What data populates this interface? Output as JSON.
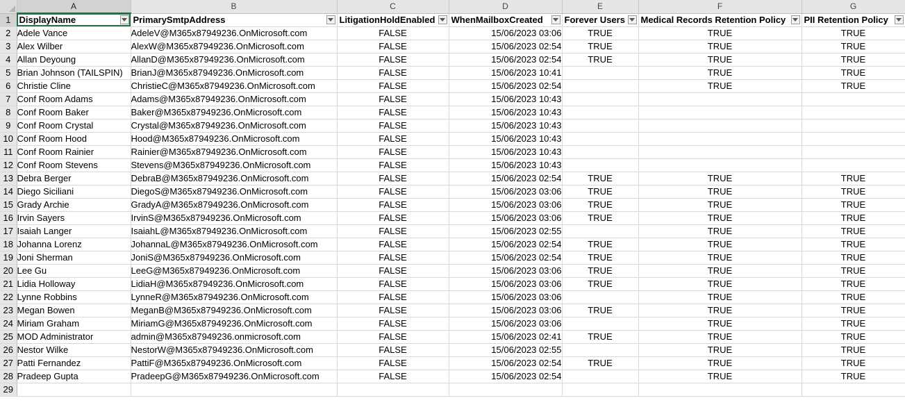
{
  "column_letters": [
    "A",
    "B",
    "C",
    "D",
    "E",
    "F",
    "G"
  ],
  "selected_column": "A",
  "headers": [
    "DisplayName",
    "PrimarySmtpAddress",
    "LitigationHoldEnabled",
    "WhenMailboxCreated",
    "Forever Users",
    "Medical Records Retention Policy",
    "PII Retention Policy"
  ],
  "header_row_number": "1",
  "rows": [
    {
      "num": "2",
      "cells": [
        "Adele Vance",
        "AdeleV@M365x87949236.OnMicrosoft.com",
        "FALSE",
        "15/06/2023 03:06",
        "TRUE",
        "TRUE",
        "TRUE"
      ]
    },
    {
      "num": "3",
      "cells": [
        "Alex Wilber",
        "AlexW@M365x87949236.OnMicrosoft.com",
        "FALSE",
        "15/06/2023 02:54",
        "TRUE",
        "TRUE",
        "TRUE"
      ]
    },
    {
      "num": "4",
      "cells": [
        "Allan Deyoung",
        "AllanD@M365x87949236.OnMicrosoft.com",
        "FALSE",
        "15/06/2023 02:54",
        "TRUE",
        "TRUE",
        "TRUE"
      ]
    },
    {
      "num": "5",
      "cells": [
        "Brian Johnson (TAILSPIN)",
        "BrianJ@M365x87949236.OnMicrosoft.com",
        "FALSE",
        "15/06/2023 10:41",
        "",
        "TRUE",
        "TRUE"
      ]
    },
    {
      "num": "6",
      "cells": [
        "Christie Cline",
        "ChristieC@M365x87949236.OnMicrosoft.com",
        "FALSE",
        "15/06/2023 02:54",
        "",
        "TRUE",
        "TRUE"
      ]
    },
    {
      "num": "7",
      "cells": [
        "Conf Room Adams",
        "Adams@M365x87949236.OnMicrosoft.com",
        "FALSE",
        "15/06/2023 10:43",
        "",
        "",
        ""
      ]
    },
    {
      "num": "8",
      "cells": [
        "Conf Room Baker",
        "Baker@M365x87949236.OnMicrosoft.com",
        "FALSE",
        "15/06/2023 10:43",
        "",
        "",
        ""
      ]
    },
    {
      "num": "9",
      "cells": [
        "Conf Room Crystal",
        "Crystal@M365x87949236.OnMicrosoft.com",
        "FALSE",
        "15/06/2023 10:43",
        "",
        "",
        ""
      ]
    },
    {
      "num": "10",
      "cells": [
        "Conf Room Hood",
        "Hood@M365x87949236.OnMicrosoft.com",
        "FALSE",
        "15/06/2023 10:43",
        "",
        "",
        ""
      ]
    },
    {
      "num": "11",
      "cells": [
        "Conf Room Rainier",
        "Rainier@M365x87949236.OnMicrosoft.com",
        "FALSE",
        "15/06/2023 10:43",
        "",
        "",
        ""
      ]
    },
    {
      "num": "12",
      "cells": [
        "Conf Room Stevens",
        "Stevens@M365x87949236.OnMicrosoft.com",
        "FALSE",
        "15/06/2023 10:43",
        "",
        "",
        ""
      ]
    },
    {
      "num": "13",
      "cells": [
        "Debra Berger",
        "DebraB@M365x87949236.OnMicrosoft.com",
        "FALSE",
        "15/06/2023 02:54",
        "TRUE",
        "TRUE",
        "TRUE"
      ]
    },
    {
      "num": "14",
      "cells": [
        "Diego Siciliani",
        "DiegoS@M365x87949236.OnMicrosoft.com",
        "FALSE",
        "15/06/2023 03:06",
        "TRUE",
        "TRUE",
        "TRUE"
      ]
    },
    {
      "num": "15",
      "cells": [
        "Grady Archie",
        "GradyA@M365x87949236.OnMicrosoft.com",
        "FALSE",
        "15/06/2023 03:06",
        "TRUE",
        "TRUE",
        "TRUE"
      ]
    },
    {
      "num": "16",
      "cells": [
        "Irvin Sayers",
        "IrvinS@M365x87949236.OnMicrosoft.com",
        "FALSE",
        "15/06/2023 03:06",
        "TRUE",
        "TRUE",
        "TRUE"
      ]
    },
    {
      "num": "17",
      "cells": [
        "Isaiah Langer",
        "IsaiahL@M365x87949236.OnMicrosoft.com",
        "FALSE",
        "15/06/2023 02:55",
        "",
        "TRUE",
        "TRUE"
      ]
    },
    {
      "num": "18",
      "cells": [
        "Johanna Lorenz",
        "JohannaL@M365x87949236.OnMicrosoft.com",
        "FALSE",
        "15/06/2023 02:54",
        "TRUE",
        "TRUE",
        "TRUE"
      ]
    },
    {
      "num": "19",
      "cells": [
        "Joni Sherman",
        "JoniS@M365x87949236.OnMicrosoft.com",
        "FALSE",
        "15/06/2023 02:54",
        "TRUE",
        "TRUE",
        "TRUE"
      ]
    },
    {
      "num": "20",
      "cells": [
        "Lee Gu",
        "LeeG@M365x87949236.OnMicrosoft.com",
        "FALSE",
        "15/06/2023 03:06",
        "TRUE",
        "TRUE",
        "TRUE"
      ]
    },
    {
      "num": "21",
      "cells": [
        "Lidia Holloway",
        "LidiaH@M365x87949236.OnMicrosoft.com",
        "FALSE",
        "15/06/2023 03:06",
        "TRUE",
        "TRUE",
        "TRUE"
      ]
    },
    {
      "num": "22",
      "cells": [
        "Lynne Robbins",
        "LynneR@M365x87949236.OnMicrosoft.com",
        "FALSE",
        "15/06/2023 03:06",
        "",
        "TRUE",
        "TRUE"
      ]
    },
    {
      "num": "23",
      "cells": [
        "Megan Bowen",
        "MeganB@M365x87949236.OnMicrosoft.com",
        "FALSE",
        "15/06/2023 03:06",
        "TRUE",
        "TRUE",
        "TRUE"
      ]
    },
    {
      "num": "24",
      "cells": [
        "Miriam Graham",
        "MiriamG@M365x87949236.OnMicrosoft.com",
        "FALSE",
        "15/06/2023 03:06",
        "",
        "TRUE",
        "TRUE"
      ]
    },
    {
      "num": "25",
      "cells": [
        "MOD Administrator",
        "admin@M365x87949236.onmicrosoft.com",
        "FALSE",
        "15/06/2023 02:41",
        "TRUE",
        "TRUE",
        "TRUE"
      ]
    },
    {
      "num": "26",
      "cells": [
        "Nestor Wilke",
        "NestorW@M365x87949236.OnMicrosoft.com",
        "FALSE",
        "15/06/2023 02:55",
        "",
        "TRUE",
        "TRUE"
      ]
    },
    {
      "num": "27",
      "cells": [
        "Patti Fernandez",
        "PattiF@M365x87949236.OnMicrosoft.com",
        "FALSE",
        "15/06/2023 02:54",
        "TRUE",
        "TRUE",
        "TRUE"
      ]
    },
    {
      "num": "28",
      "cells": [
        "Pradeep Gupta",
        "PradeepG@M365x87949236.OnMicrosoft.com",
        "FALSE",
        "15/06/2023 02:54",
        "",
        "TRUE",
        "TRUE"
      ]
    },
    {
      "num": "29",
      "cells": [
        "",
        "",
        "",
        "",
        "",
        "",
        ""
      ]
    }
  ],
  "colors": {
    "accent": "#217346",
    "gridline": "#d9d9d9",
    "header_bg": "#e6e6e6",
    "selected_header_bg": "#d2d2d2"
  }
}
